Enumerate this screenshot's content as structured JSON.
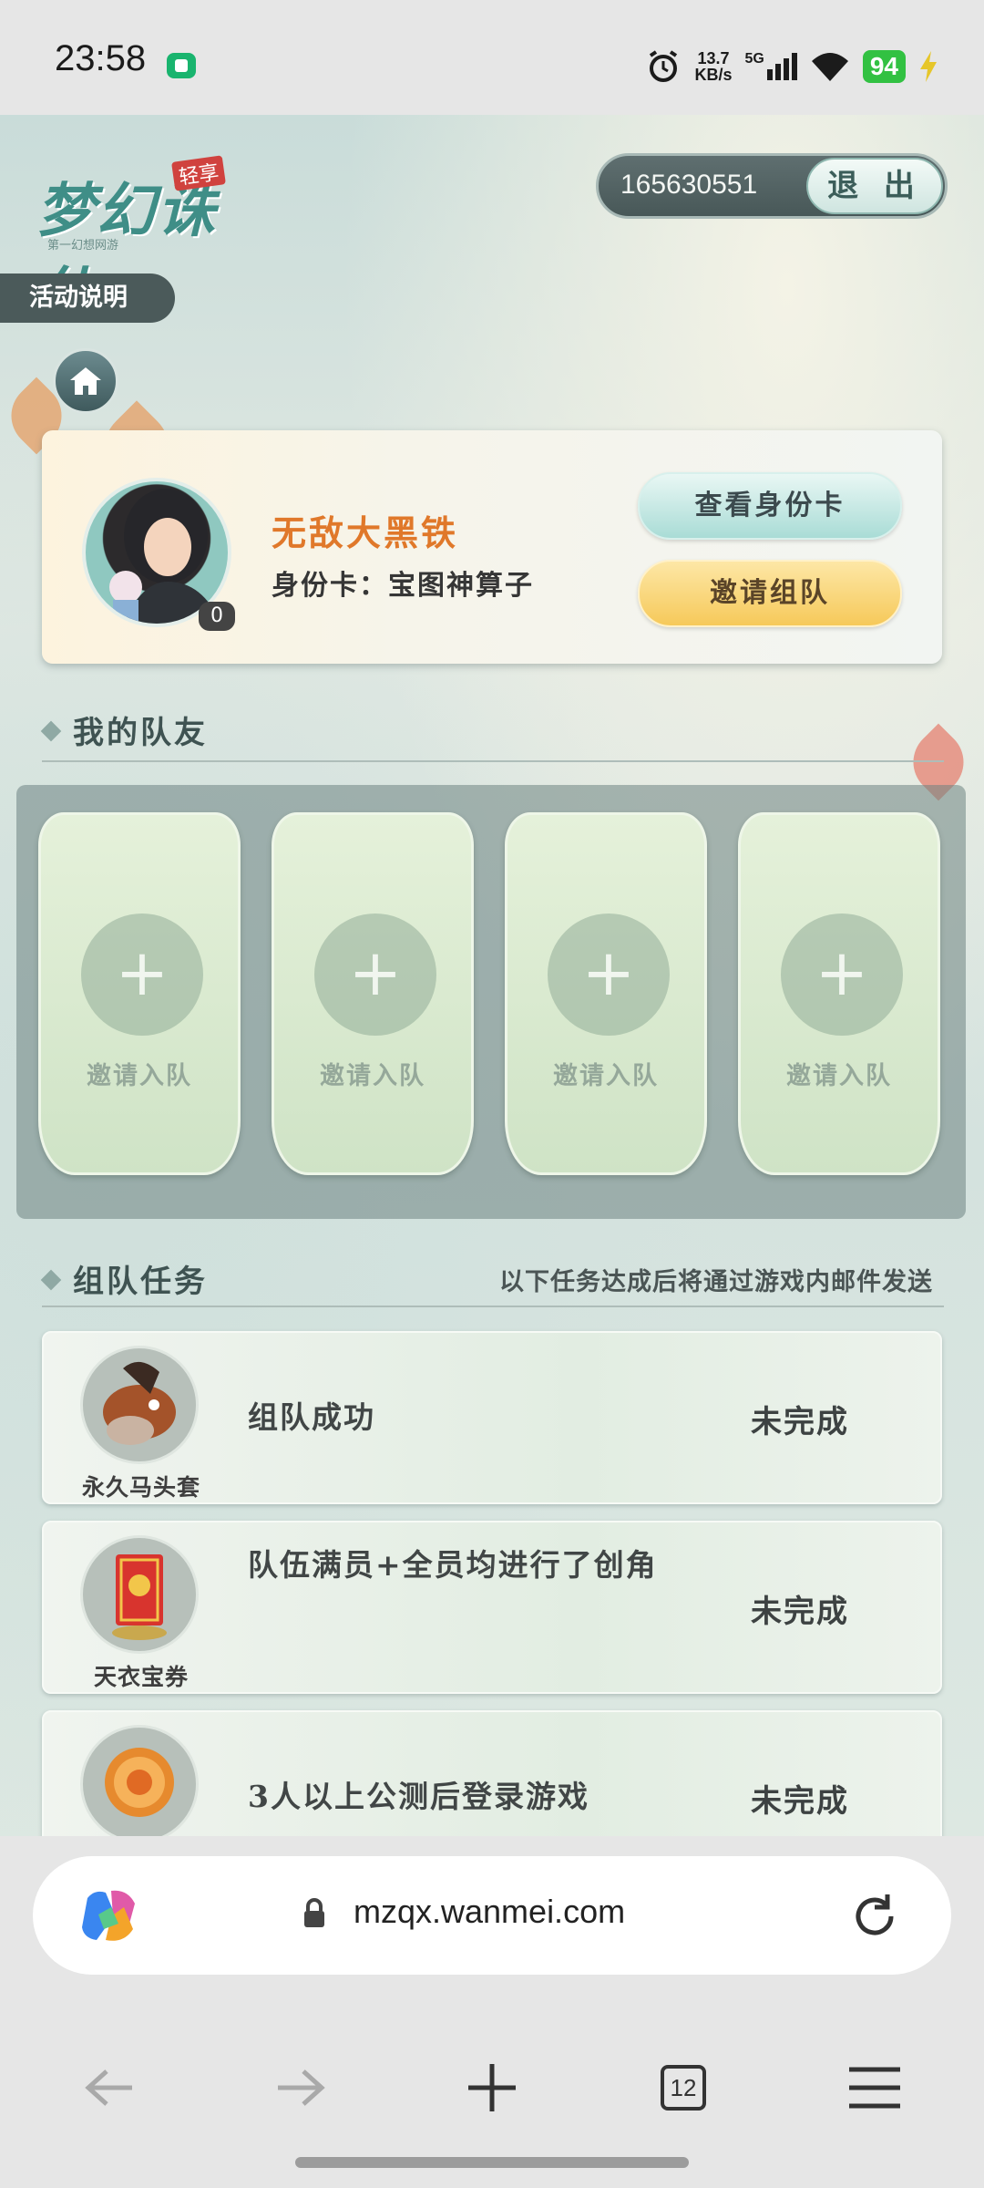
{
  "status_bar": {
    "time": "23:58",
    "net_speed_value": "13.7",
    "net_speed_unit": "KB/s",
    "network": "5G",
    "battery": "94"
  },
  "header": {
    "logo_text": "梦幻诛仙",
    "logo_tag": "轻享",
    "logo_sub": "第一幻想网游",
    "account_id": "165630551",
    "logout_label": "退 出"
  },
  "rules_label": "活动说明",
  "profile": {
    "name": "无敌大黑铁",
    "role": "身份卡：宝图神算子",
    "avatar_badge": "0",
    "view_card_label": "查看身份卡",
    "invite_team_label": "邀请组队"
  },
  "teammates": {
    "title": "我的队友",
    "slots": [
      {
        "label": "邀请入队"
      },
      {
        "label": "邀请入队"
      },
      {
        "label": "邀请入队"
      },
      {
        "label": "邀请入队"
      }
    ]
  },
  "tasks": {
    "title": "组队任务",
    "note": "以下任务达成后将通过游戏内邮件发送",
    "items": [
      {
        "reward": "永久马头套",
        "title": "组队成功",
        "status": "未完成",
        "icon": "horse-head-icon"
      },
      {
        "reward": "天衣宝券",
        "title": "队伍满员+全员均进行了创角",
        "status": "未完成",
        "icon": "ticket-icon"
      },
      {
        "reward": "",
        "title": "3人以上公测后登录游戏",
        "status": "未完成",
        "icon": "gold-coin-icon"
      }
    ]
  },
  "browser": {
    "url": "mzqx.wanmei.com",
    "tab_count": "12"
  },
  "colors": {
    "accent_orange": "#e0782a",
    "battery_green": "#32c142",
    "panel_teal": "#a9dcd6",
    "invite_gold": "#f6c95a"
  }
}
